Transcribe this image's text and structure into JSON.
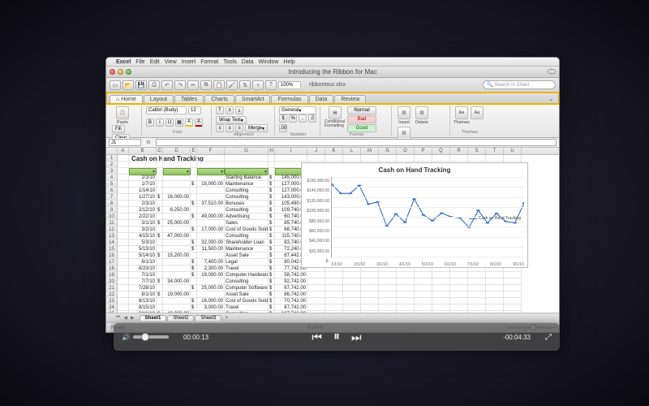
{
  "menubar": {
    "apple": "",
    "app": "Excel",
    "items": [
      "File",
      "Edit",
      "View",
      "Insert",
      "Format",
      "Tools",
      "Data",
      "Window",
      "Help"
    ]
  },
  "titlebar": {
    "title": "Introducing the Ribbon for Mac"
  },
  "toolbar": {
    "filename": "ribbontour.xlsx",
    "zoom": "100%",
    "search_placeholder": "Search in Sheet"
  },
  "ribbon_tabs": [
    "Home",
    "Layout",
    "Tables",
    "Charts",
    "SmartArt",
    "Formulas",
    "Data",
    "Review"
  ],
  "ribbon": {
    "edit": {
      "label": "Edit",
      "paste": "Paste",
      "fill": "Fill",
      "clear": "Clear"
    },
    "font": {
      "label": "Font",
      "name": "Calibri (Body)",
      "size": "12",
      "bold": "B",
      "italic": "I",
      "underline": "U"
    },
    "alignment": {
      "label": "Alignment",
      "wrap": "Wrap Text",
      "merge": "Merge"
    },
    "number": {
      "label": "Number",
      "format": "General"
    },
    "format_group": {
      "label": "Format",
      "conditional": "Conditional Formatting",
      "styles": {
        "normal": "Normal",
        "bad": "Bad",
        "good": "Good"
      }
    },
    "cells": {
      "label": "Cells",
      "insert": "Insert",
      "delete": "Delete",
      "format": "Format"
    },
    "themes": {
      "label": "Themes",
      "themes": "Themes",
      "aa": "Aa"
    }
  },
  "formula_bar": {
    "cell_ref": "J1",
    "fx": "fx"
  },
  "sheet": {
    "title": "Cash on Hand Tracking",
    "columns": [
      "A",
      "B",
      "C",
      "D",
      "E",
      "F",
      "G",
      "H",
      "I",
      "J",
      "K",
      "L",
      "M",
      "N",
      "O",
      "P",
      "Q",
      "R",
      "S",
      "T",
      "U"
    ],
    "header_row_blank_arrows": [
      "▾",
      "",
      "▾",
      "",
      "▾",
      "▾",
      "",
      "▾"
    ],
    "rows": [
      {
        "date": "1/1/10",
        "b": "",
        "d": "",
        "e": "",
        "desc": "Starting Balance",
        "g": "$",
        "i": "145,000.00"
      },
      {
        "date": "1/7/10",
        "b": "",
        "d": "18,000.00",
        "e": "",
        "desc": "Maintenance",
        "g": "$",
        "i": "127,000.00"
      },
      {
        "date": "1/14/10",
        "b": "",
        "d": "",
        "e": "",
        "desc": "Consulting",
        "g": "$",
        "i": "127,000.00"
      },
      {
        "date": "1/27/10",
        "b": "16,000.00",
        "d": "",
        "e": "",
        "desc": "Consulting",
        "g": "$",
        "i": "143,000.00"
      },
      {
        "date": "2/3/10",
        "b": "",
        "c": "$",
        "d": "37,510.00",
        "e": "",
        "desc": "Bonuses",
        "g": "$",
        "i": "105,490.00"
      },
      {
        "date": "2/12/10",
        "b": "6,250.00",
        "d": "",
        "e": "",
        "desc": "Consulting",
        "g": "$",
        "i": "109,740.00"
      },
      {
        "date": "2/22/10",
        "b": "",
        "c": "$",
        "d": "49,000.00",
        "e": "",
        "desc": "Advertising",
        "g": "$",
        "i": "60,740.00"
      },
      {
        "date": "3/1/10",
        "b": "25,000.00",
        "d": "",
        "e": "",
        "desc": "Sales",
        "g": "$",
        "i": "85,740.00"
      },
      {
        "date": "3/2/10",
        "b": "",
        "c": "$",
        "d": "17,000.00",
        "e": "",
        "desc": "Cost of Goods Sold",
        "g": "$",
        "i": "68,740.00"
      },
      {
        "date": "4/15/10",
        "b": "47,000.00",
        "d": "",
        "e": "",
        "desc": "Consulting",
        "g": "$",
        "i": "115,740.00"
      },
      {
        "date": "5/3/10",
        "b": "",
        "c": "$",
        "d": "32,000.00",
        "e": "",
        "desc": "Shareholder Loan",
        "g": "$",
        "i": "83,740.00"
      },
      {
        "date": "5/13/10",
        "b": "",
        "c": "$",
        "d": "11,500.00",
        "e": "",
        "desc": "Maintenance",
        "g": "$",
        "i": "72,240.00"
      },
      {
        "date": "5/14/10",
        "b": "15,200.00",
        "d": "",
        "c": "$",
        "e": "",
        "desc": "Asset Sale",
        "g": "$",
        "i": "87,442.00"
      },
      {
        "date": "6/1/10",
        "b": "",
        "c": "$",
        "d": "7,400.00",
        "e": "",
        "desc": "Legal",
        "g": "$",
        "i": "80,042.00"
      },
      {
        "date": "6/23/10",
        "b": "",
        "c": "$",
        "d": "2,300.00",
        "e": "",
        "desc": "Travel",
        "g": "$",
        "i": "77,742.00"
      },
      {
        "date": "7/1/10",
        "b": "",
        "c": "$",
        "d": "19,000.00",
        "e": "",
        "desc": "Computer Hardware",
        "g": "$",
        "i": "58,742.00"
      },
      {
        "date": "7/7/10",
        "b": "34,000.00",
        "d": "",
        "e": "",
        "desc": "Consulting",
        "g": "$",
        "i": "92,742.00"
      },
      {
        "date": "7/28/10",
        "b": "",
        "c": "$",
        "d": "25,000.00",
        "e": "",
        "desc": "Computer Software",
        "g": "$",
        "i": "67,742.00"
      },
      {
        "date": "8/1/10",
        "b": "19,000.00",
        "d": "",
        "e": "",
        "desc": "Asset Sale",
        "g": "$",
        "i": "86,742.00"
      },
      {
        "date": "8/13/10",
        "b": "",
        "c": "$",
        "d": "16,000.00",
        "e": "",
        "desc": "Cost of Goods Sold",
        "g": "$",
        "i": "70,742.00"
      },
      {
        "date": "8/15/10",
        "b": "",
        "c": "$",
        "d": "3,000.00",
        "e": "",
        "desc": "Travel",
        "g": "$",
        "i": "67,742.00"
      },
      {
        "date": "8/18/10",
        "b": "40,000.00",
        "d": "",
        "e": "",
        "desc": "Consulting",
        "g": "$",
        "i": "107,742.00"
      }
    ]
  },
  "chart_data": {
    "type": "line",
    "title": "Cash on Hand Tracking",
    "xlabel": "",
    "ylabel": "",
    "ylim": [
      0,
      160000
    ],
    "y_ticks": [
      "$160,000.00",
      "$140,000.00",
      "$120,000.00",
      "$100,000.00",
      "$80,000.00",
      "$60,000.00",
      "$40,000.00",
      "$20,000.00",
      "$-"
    ],
    "x_ticks": [
      "1/1/10",
      "2/1/10",
      "3/1/10",
      "4/1/10",
      "5/1/10",
      "6/1/10",
      "7/1/10",
      "8/1/10",
      "9/1/10"
    ],
    "series": [
      {
        "name": "Cash on Hand Tracking",
        "color": "#3b78c4",
        "x": [
          "1/1/10",
          "1/7/10",
          "1/14/10",
          "1/27/10",
          "2/3/10",
          "2/12/10",
          "2/22/10",
          "3/1/10",
          "3/2/10",
          "4/15/10",
          "5/3/10",
          "5/13/10",
          "5/14/10",
          "6/1/10",
          "6/23/10",
          "7/1/10",
          "7/7/10",
          "7/28/10",
          "8/1/10",
          "8/13/10",
          "8/15/10",
          "8/18/10"
        ],
        "values": [
          145000,
          127000,
          127000,
          143000,
          105490,
          109740,
          60740,
          85740,
          68740,
          115740,
          83740,
          72240,
          87442,
          80042,
          77742,
          58742,
          92742,
          67742,
          86742,
          70742,
          67742,
          107742
        ]
      }
    ]
  },
  "sheet_tabs": {
    "tabs": [
      "Sheet1",
      "Sheet2",
      "Sheet3"
    ],
    "active": 0,
    "add": "+"
  },
  "status": {
    "ready": "Ready",
    "sum": "Sum=0"
  },
  "video": {
    "elapsed": "00:00:13",
    "remaining": "-00:04:33",
    "vol_icon": "🔊",
    "prev": "⏮",
    "pause": "⏸",
    "next": "⏭",
    "fullscreen": "⤢"
  }
}
